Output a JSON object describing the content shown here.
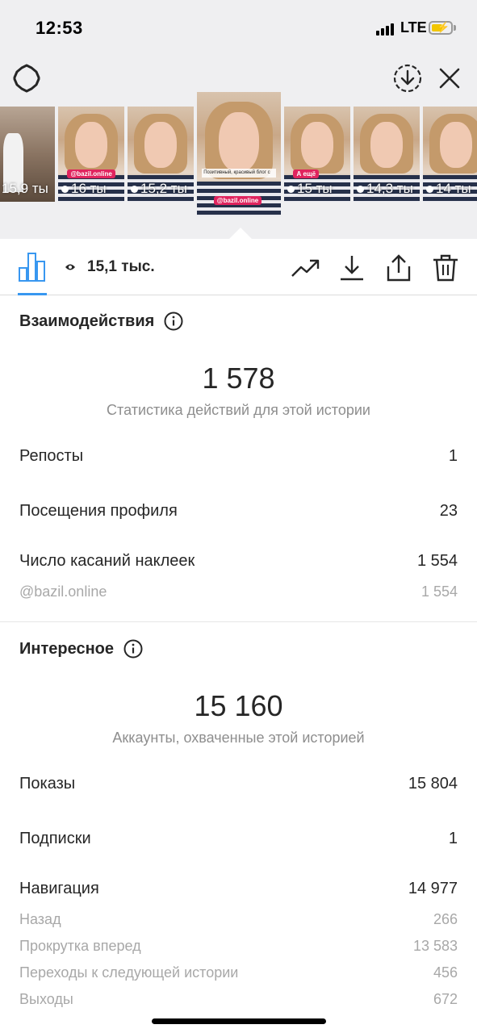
{
  "status_bar": {
    "time": "12:53",
    "network": "LTE"
  },
  "thumbnails": [
    {
      "views": "15,9 ты",
      "tag": ""
    },
    {
      "views": "16 ты",
      "tag": "@bazil.online"
    },
    {
      "views": "15,2 ты",
      "tag": ""
    },
    {
      "views": "",
      "tag": "@bazil.online",
      "caption": "Позитивный, красивый блог с"
    },
    {
      "views": "15 ты",
      "tag": "А ещё"
    },
    {
      "views": "14,3 ты",
      "tag": ""
    },
    {
      "views": "14 ты",
      "tag": ""
    }
  ],
  "tabbar": {
    "views_total": "15,1 тыс."
  },
  "interactions": {
    "title": "Взаимодействия",
    "total": "1 578",
    "caption": "Статистика действий для этой истории",
    "rows": [
      {
        "label": "Репосты",
        "value": "1"
      },
      {
        "label": "Посещения профиля",
        "value": "23"
      },
      {
        "label": "Число касаний наклеек",
        "value": "1 554"
      }
    ],
    "sub_rows": [
      {
        "label": "@bazil.online",
        "value": "1 554"
      }
    ]
  },
  "discovery": {
    "title": "Интересное",
    "total": "15 160",
    "caption": "Аккаунты, охваченные этой историей",
    "rows": [
      {
        "label": "Показы",
        "value": "15 804"
      },
      {
        "label": "Подписки",
        "value": "1"
      },
      {
        "label": "Навигация",
        "value": "14 977"
      }
    ],
    "sub_rows": [
      {
        "label": "Назад",
        "value": "266"
      },
      {
        "label": "Прокрутка вперед",
        "value": "13 583"
      },
      {
        "label": "Переходы к следующей истории",
        "value": "456"
      },
      {
        "label": "Выходы",
        "value": "672"
      }
    ]
  },
  "colors": {
    "accent": "#3897f0",
    "secondary_text": "#8e8e8e",
    "top_background": "#efeff1"
  }
}
